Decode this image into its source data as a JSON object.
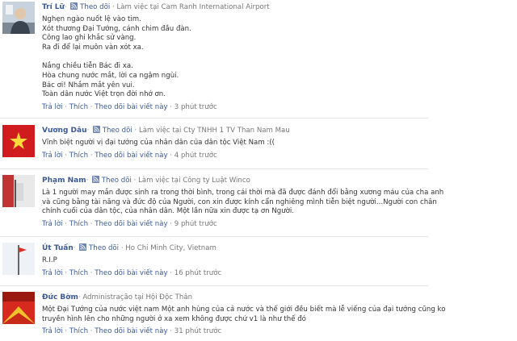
{
  "labels": {
    "follow": "Theo dõi",
    "reply": "Trả lời",
    "like": "Thích",
    "follow_post": "Theo dõi bài viết này",
    "sep": "·"
  },
  "comments": [
    {
      "name": "Trí Lữ",
      "workplace": "Làm việc tại Cam Ranh International Airport",
      "text": [
        "Nghẹn ngào nuốt lệ vào tim.",
        "Xót thương Đại Tướng, cánh chim đầu đàn.",
        "Công lao ghi khắc sử vàng.",
        "Ra đi để lại muôn vàn xót xa.",
        "Nắng chiều tiễn Bác đi xa.",
        "Hòa chung nước mắt, lời ca ngậm ngùi.",
        "Bác ơi! Nhắm mắt yên vui.",
        "Toàn dân nước Việt trọn đời nhớ ơn."
      ],
      "time": "3 phút trước"
    },
    {
      "name": "Vương Dâu",
      "workplace": "Làm việc tại Cty TNHH 1 TV Than Nam Mau",
      "text": [
        "Vĩnh biệt người vị đại tướng của nhân dân của dân tộc Việt Nam :(("
      ],
      "time": "4 phút trước"
    },
    {
      "name": "Phạm Nam",
      "workplace": "Làm việc tại Công ty Luật Winco",
      "text": [
        "Là 1 người may mắn được sinh ra trong thời bình, trong cái thời mà đã được đánh đổi bằng xương máu của cha anh",
        "và cũng bằng tài năng và đức độ của Người, con xin được kính cẩn nghiêng mình tiễn biệt người...Người con chân",
        "chính cuối của dân tộc, của nhân dân. Một lần nữa xin được tạ ơn Người."
      ],
      "time": "9 phút trước"
    },
    {
      "name": "Út Tuấn",
      "workplace": "Ho Chi Minh City, Vietnam",
      "text": [
        "R.I.P"
      ],
      "time": "16 phút trước"
    },
    {
      "name": "Đức Bờm",
      "workplace": "Administração tại Hội Độc Thân",
      "text": [
        "Một Đại Tướng của nước việt nam Một anh hùng của cả nước và thế giới đều biết mà lễ viếng của đại tướng cũng ko",
        "truyền hình lên cho những người ở xa xem không được chứ v1 là như thế đó"
      ],
      "time": "31 phút trước"
    }
  ]
}
